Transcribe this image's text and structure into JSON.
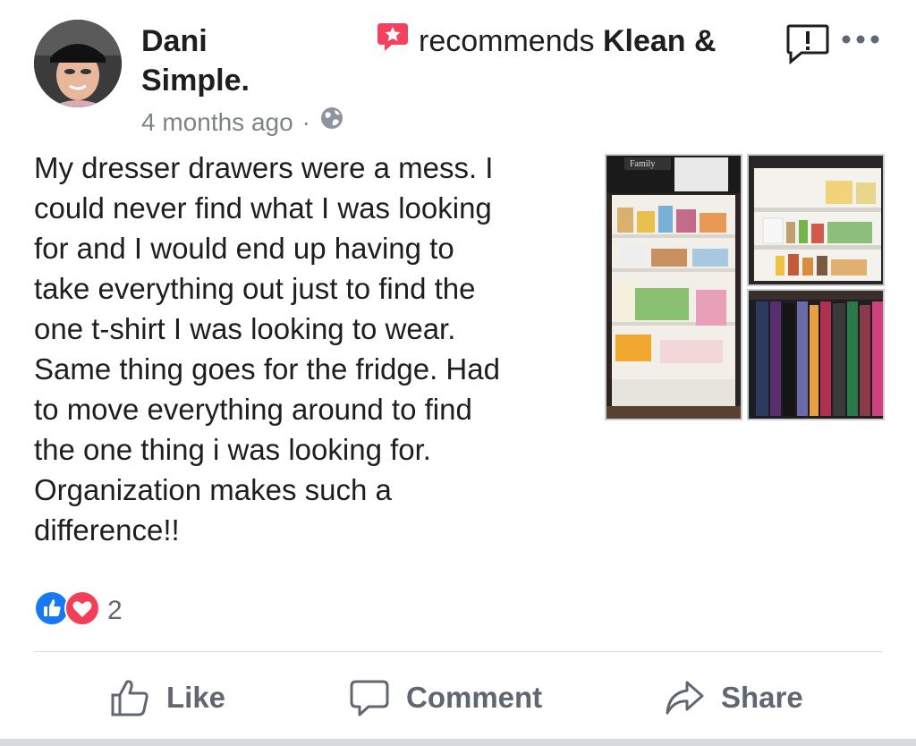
{
  "post": {
    "author_first": "Dani",
    "recommends_text": "recommends",
    "page_name_part1": "Klean &",
    "page_name_part2": "Simple.",
    "timestamp": "4 months ago",
    "separator": "·",
    "privacy_icon": "globe-icon",
    "body": "My dresser drawers were a mess. I\ncould never find what I was looking\nfor and I would end up having to\ntake everything out just to find the\none t-shirt I was looking to wear.\nSame thing goes for the fridge. Had\nto move everything around to find\nthe one thing i was looking for.\nOrganization makes such a\ndifference!!",
    "photos": [
      "fridge-photo",
      "fridge-shelves-photo",
      "drawer-shirts-photo"
    ],
    "photo_sign_text": "Family"
  },
  "reactions": {
    "icons": [
      "like-reaction-icon",
      "love-reaction-icon"
    ],
    "count": "2"
  },
  "actions": {
    "like_label": "Like",
    "comment_label": "Comment",
    "share_label": "Share"
  },
  "colors": {
    "text": "#1c1e21",
    "muted": "#606770",
    "like_blue": "#1877f2",
    "love_red": "#f33e58",
    "recommend_badge": "#f3425f"
  }
}
